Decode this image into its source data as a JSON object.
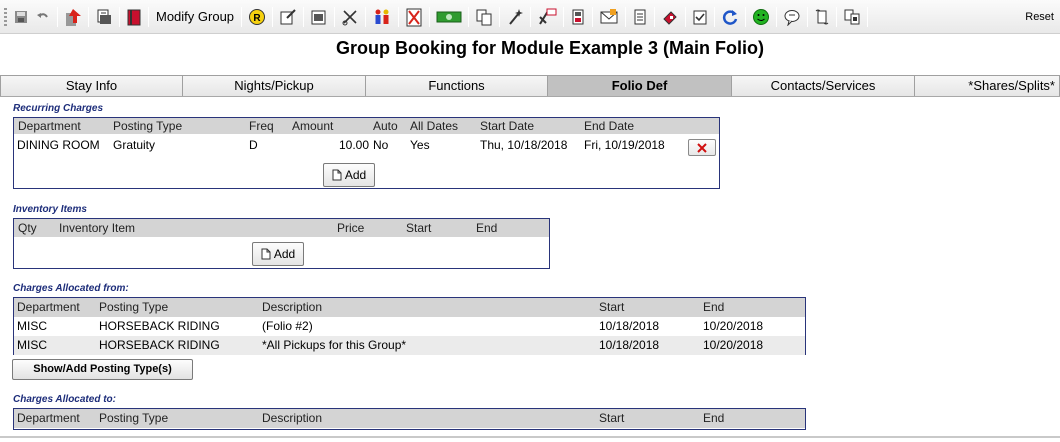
{
  "toolbar": {
    "modify_group_label": "Modify Group",
    "reset_label": "Reset",
    "icons": [
      "save-icon",
      "undo-icon",
      "exit-icon",
      "print-report-icon",
      "book-icon",
      "modify-group",
      "yield-icon",
      "edit-doc-icon",
      "notes-icon",
      "cut-icon",
      "people-icon",
      "cancel-doc-icon",
      "money-icon",
      "copy-icon",
      "wand-icon",
      "bill-icon",
      "calculator-icon",
      "envelope-icon",
      "document-icon",
      "eraser-icon",
      "checklist-icon",
      "refresh-icon",
      "smiley-icon",
      "speech-icon",
      "scroll-icon",
      "transfer-icon",
      "reset"
    ]
  },
  "title": "Group Booking for Module Example 3 (Main Folio)",
  "tabs": [
    {
      "label": "Stay Info"
    },
    {
      "label": "Nights/Pickup"
    },
    {
      "label": "Functions"
    },
    {
      "label": "Folio Def",
      "active": true
    },
    {
      "label": "Contacts/Services"
    },
    {
      "label": "*Shares/Splits*"
    }
  ],
  "recurring": {
    "label": "Recurring Charges",
    "headers": [
      "Department",
      "Posting Type",
      "Freq",
      "Amount",
      "Auto",
      "All Dates",
      "Start Date",
      "End Date"
    ],
    "rows": [
      {
        "department": "DINING ROOM",
        "posting_type": "Gratuity",
        "freq": "D",
        "amount": "10.00",
        "auto": "No",
        "all_dates": "Yes",
        "start": "Thu, 10/18/2018",
        "end": "Fri, 10/19/2018"
      }
    ],
    "add_label": "Add"
  },
  "inventory": {
    "label": "Inventory Items",
    "headers": [
      "Qty",
      "Inventory Item",
      "Price",
      "Start",
      "End"
    ],
    "add_label": "Add"
  },
  "alloc_from": {
    "label": "Charges Allocated from:",
    "headers": [
      "Department",
      "Posting Type",
      "Description",
      "Start",
      "End"
    ],
    "rows": [
      {
        "department": "MISC",
        "posting_type": "HORSEBACK RIDING",
        "description": "(Folio #2)",
        "start": "10/18/2018",
        "end": "10/20/2018"
      },
      {
        "department": "MISC",
        "posting_type": "HORSEBACK RIDING",
        "description": "*All Pickups for this Group*",
        "start": "10/18/2018",
        "end": "10/20/2018"
      }
    ],
    "button_label": "Show/Add Posting Type(s)"
  },
  "alloc_to": {
    "label": "Charges Allocated to:",
    "headers": [
      "Department",
      "Posting Type",
      "Description",
      "Start",
      "End"
    ]
  },
  "colors": {
    "section_label": "#1d2d7a",
    "box_border": "#29347a",
    "header_bg": "#d4d4d4",
    "active_tab": "#c1c1c1",
    "delete_x": "#d01010"
  }
}
